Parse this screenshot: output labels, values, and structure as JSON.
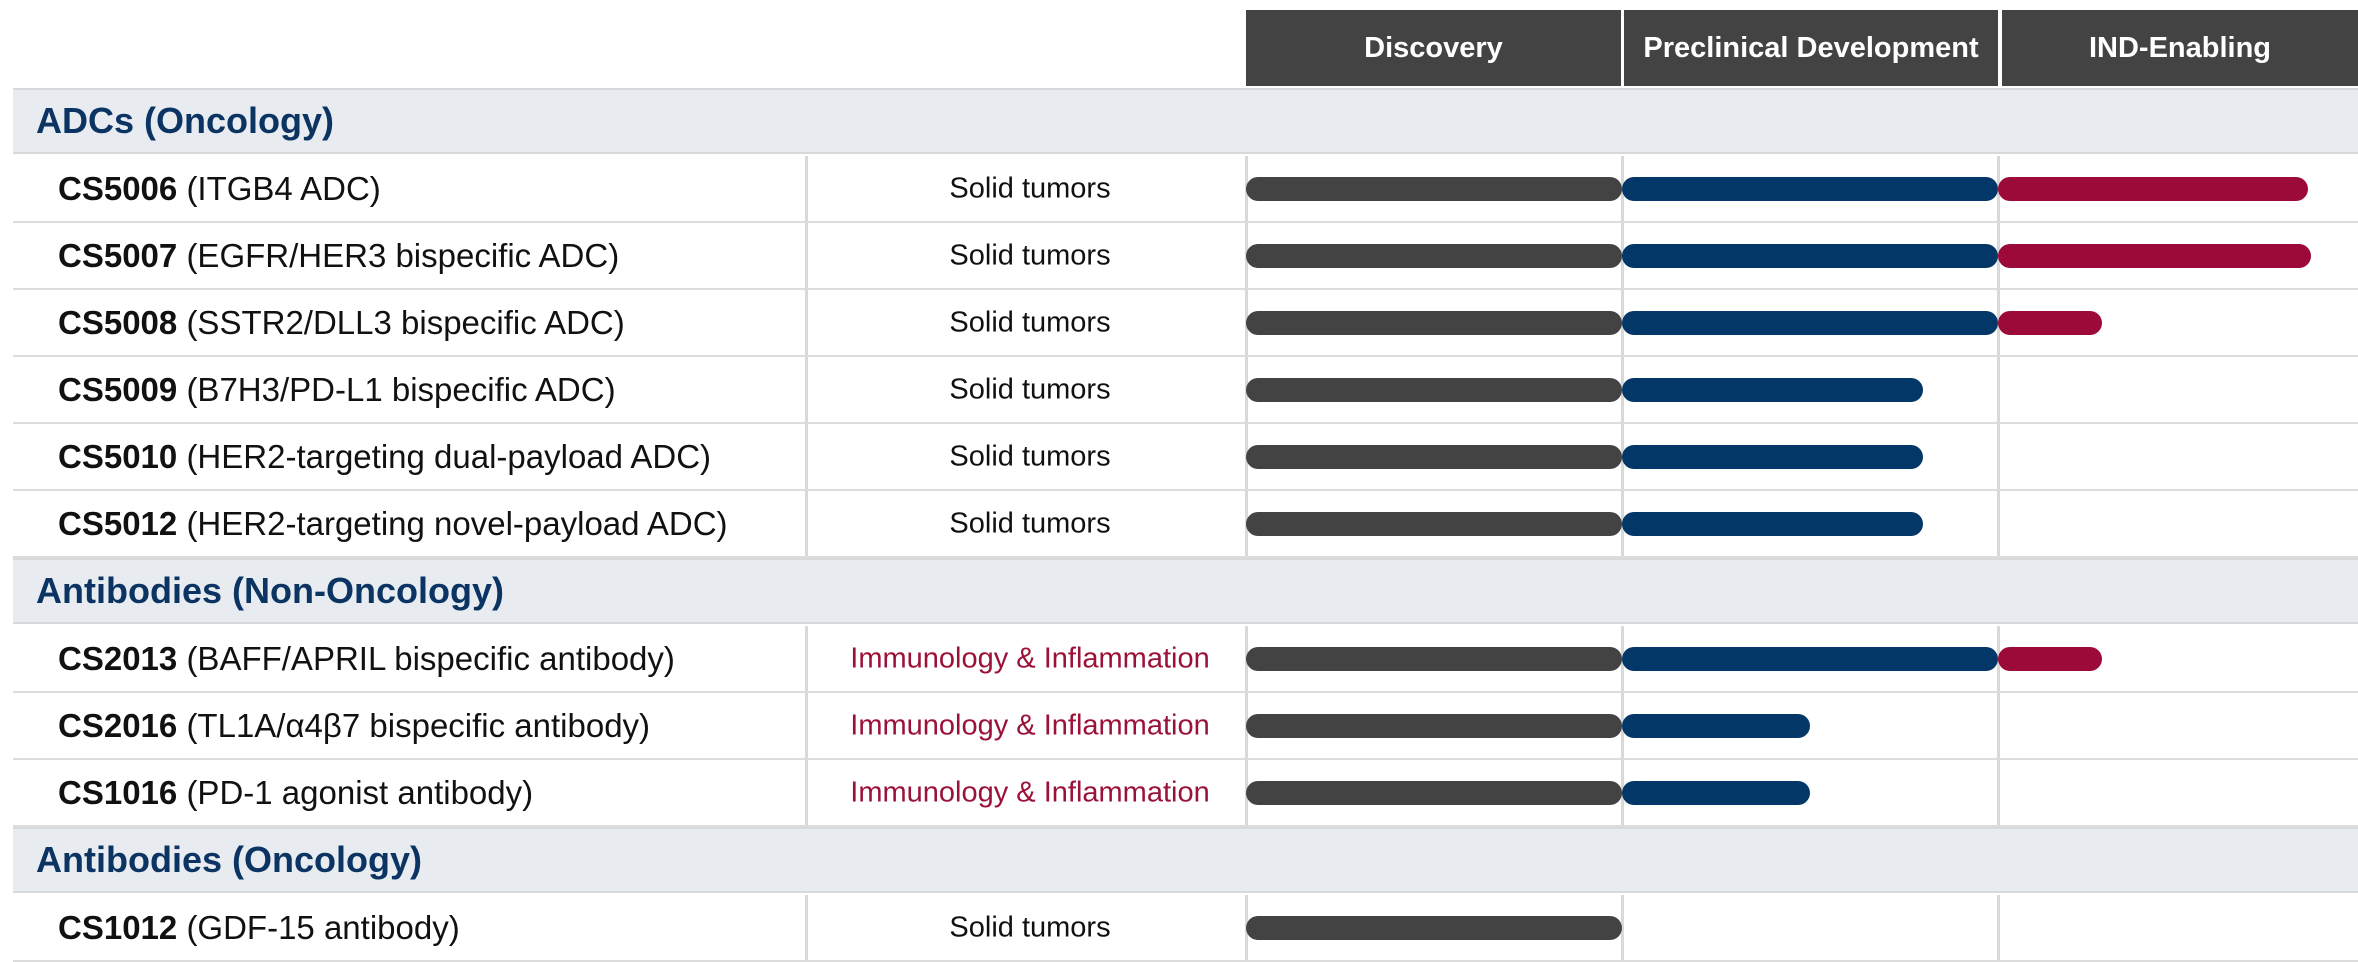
{
  "colors": {
    "header_bg": "#434343",
    "section_bg": "#e8ecf0",
    "section_text": "#0c3463",
    "discovery": "#434343",
    "preclinical": "#023767",
    "ind_enabling": "#9b0a39",
    "inflammation_text": "#9b1238"
  },
  "chart_data": {
    "type": "table",
    "phases": [
      "Discovery",
      "Preclinical Development",
      "IND-Enabling"
    ],
    "progress_scale": "0 = start of Discovery, 3 = end of IND-Enabling",
    "sections": [
      {
        "title": "ADCs (Oncology)",
        "programs": [
          {
            "code": "CS5006",
            "desc": "(ITGB4 ADC)",
            "indication": "Solid tumors",
            "indication_type": "oncology",
            "progress": 2.86
          },
          {
            "code": "CS5007",
            "desc": "(EGFR/HER3 bispecific ADC)",
            "indication": "Solid tumors",
            "indication_type": "oncology",
            "progress": 2.87
          },
          {
            "code": "CS5008",
            "desc": "(SSTR2/DLL3 bispecific ADC)",
            "indication": "Solid tumors",
            "indication_type": "oncology",
            "progress": 2.29
          },
          {
            "code": "CS5009",
            "desc": "(B7H3/PD-L1 bispecific ADC)",
            "indication": "Solid tumors",
            "indication_type": "oncology",
            "progress": 1.8
          },
          {
            "code": "CS5010",
            "desc": "(HER2-targeting dual-payload ADC)",
            "indication": "Solid tumors",
            "indication_type": "oncology",
            "progress": 1.8
          },
          {
            "code": "CS5012",
            "desc": "(HER2-targeting novel-payload ADC)",
            "indication": "Solid tumors",
            "indication_type": "oncology",
            "progress": 1.8
          }
        ]
      },
      {
        "title": "Antibodies (Non-Oncology)",
        "programs": [
          {
            "code": "CS2013",
            "desc": "(BAFF/APRIL bispecific antibody)",
            "indication": "Immunology & Inflammation",
            "indication_type": "inflammation",
            "progress": 2.29
          },
          {
            "code": "CS2016",
            "desc": "(TL1A/α4β7 bispecific antibody)",
            "indication": "Immunology & Inflammation",
            "indication_type": "inflammation",
            "progress": 1.5
          },
          {
            "code": "CS1016",
            "desc": "(PD-1 agonist antibody)",
            "indication": "Immunology & Inflammation",
            "indication_type": "inflammation",
            "progress": 1.5
          }
        ]
      },
      {
        "title": "Antibodies (Oncology)",
        "programs": [
          {
            "code": "CS1012",
            "desc": "(GDF-15 antibody)",
            "indication": "Solid tumors",
            "indication_type": "oncology",
            "progress": 1.0
          }
        ]
      }
    ]
  }
}
